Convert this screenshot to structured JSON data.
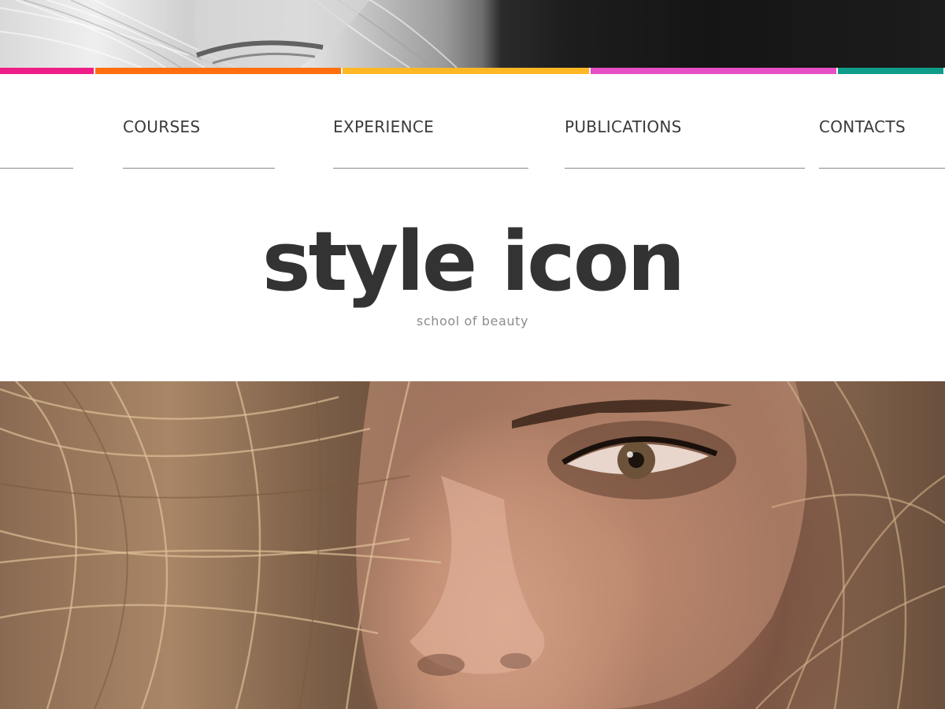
{
  "brand": {
    "name": "style icon",
    "tagline": "school of beauty"
  },
  "nav": {
    "items": [
      {
        "label": "COURSES"
      },
      {
        "label": "EXPERIENCE"
      },
      {
        "label": "PUBLICATIONS"
      },
      {
        "label": "CONTACTS"
      }
    ]
  },
  "color_bar": {
    "colors": [
      "#ee1e88",
      "#ff6f0f",
      "#ffb824",
      "#e64fc6",
      "#0f9d8a"
    ]
  },
  "images": {
    "top_banner": "grayscale-blonde-portrait-crop",
    "hero": "woman-face-with-windblown-hair"
  }
}
